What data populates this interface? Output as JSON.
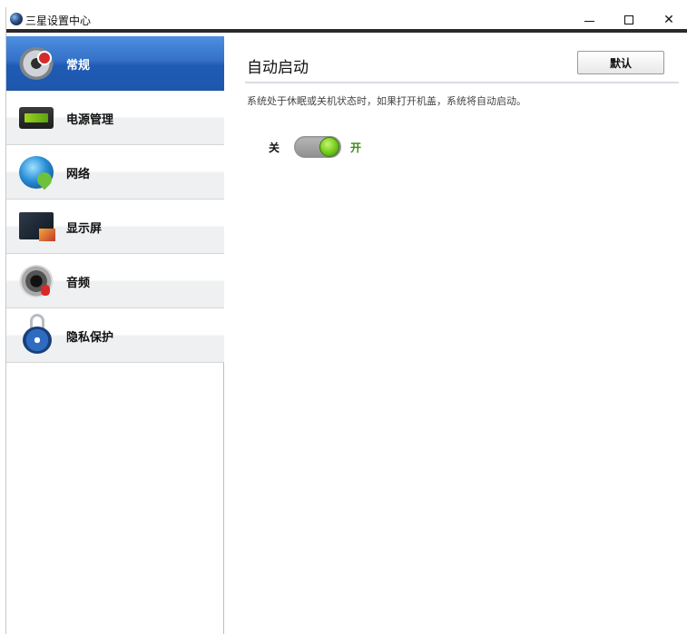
{
  "window": {
    "title": "三星设置中心",
    "icons": {
      "app": "globe-icon",
      "minimize": "minimize-icon",
      "maximize": "maximize-icon",
      "close": "close-icon"
    },
    "close_glyph": "✕"
  },
  "sidebar": {
    "active_index": 0,
    "active_color": "#2b66bf",
    "items": [
      {
        "label": "常规",
        "icon": "gear-icon"
      },
      {
        "label": "电源管理",
        "icon": "battery-icon"
      },
      {
        "label": "网络",
        "icon": "network-globe-icon"
      },
      {
        "label": "显示屏",
        "icon": "monitor-icon"
      },
      {
        "label": "音频",
        "icon": "speaker-icon"
      },
      {
        "label": "隐私保护",
        "icon": "padlock-icon"
      }
    ]
  },
  "main": {
    "section_title": "自动启动",
    "default_button_label": "默认",
    "description": "系统处于休眠或关机状态时，如果打开机盖，系统将自动启动。",
    "toggle": {
      "off_label": "关",
      "on_label": "开",
      "state": "on",
      "on_color": "#7ed321"
    }
  }
}
